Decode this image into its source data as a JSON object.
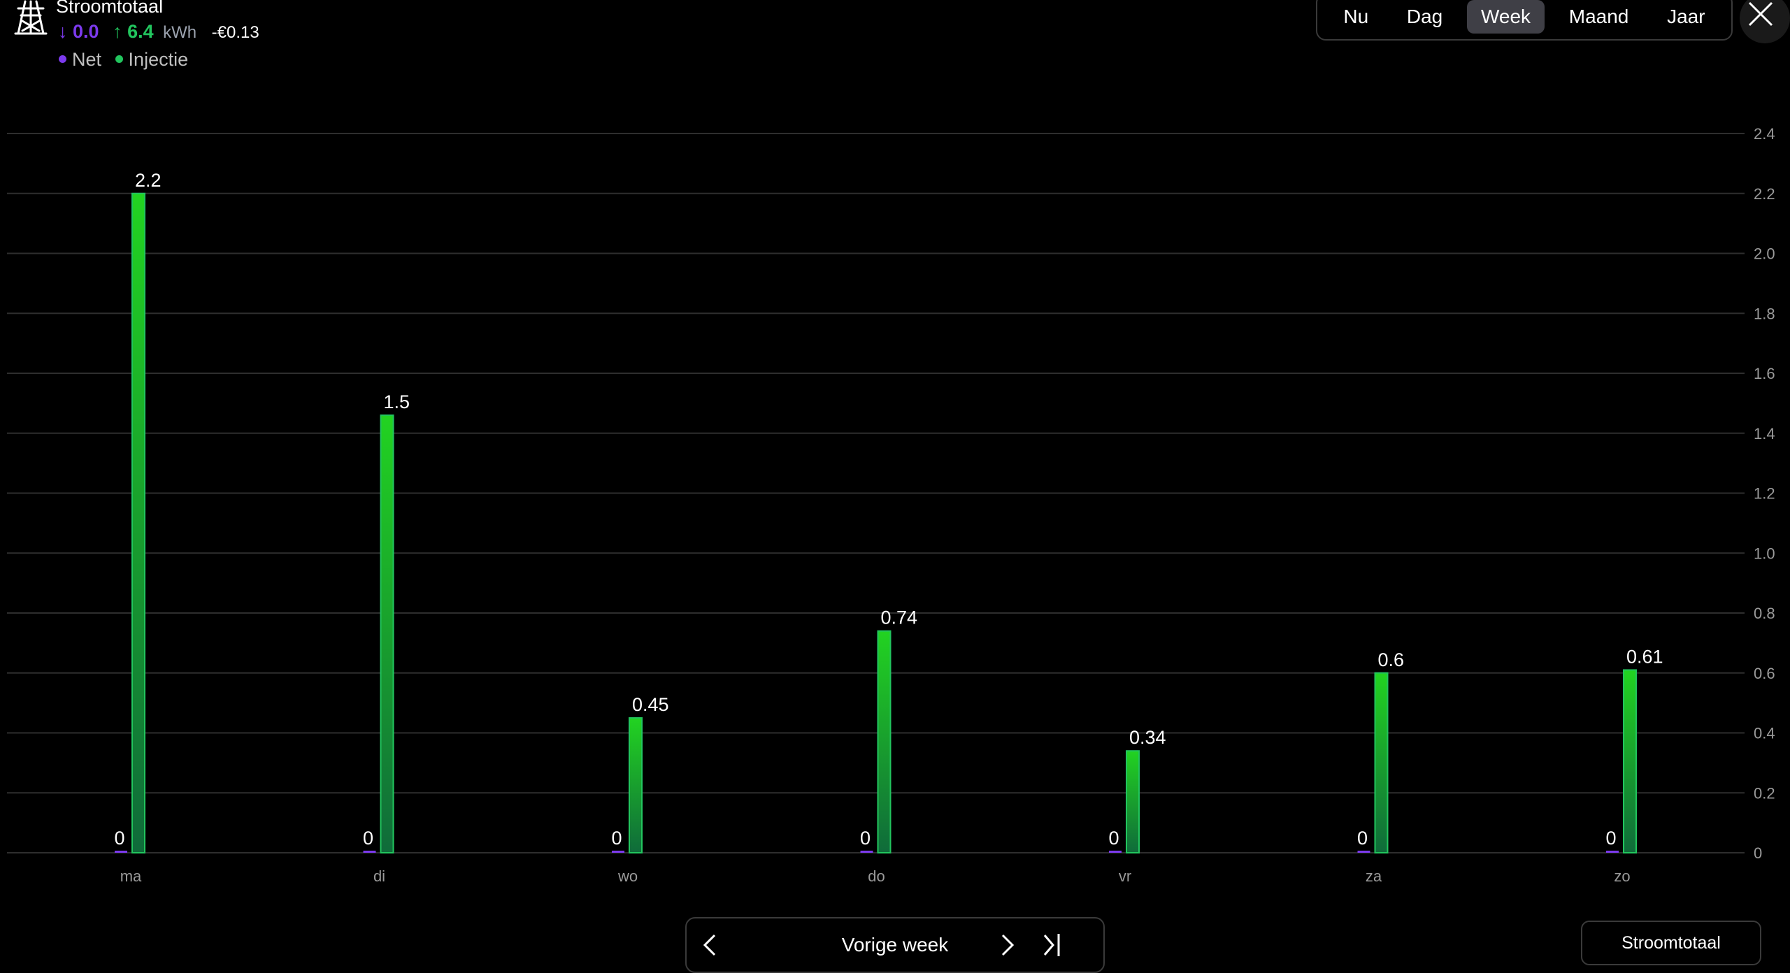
{
  "header": {
    "title": "Stroomtotaal",
    "net_value": "0.0",
    "injection_value": "6.4",
    "unit": "kWh",
    "cost": "-€0.13",
    "legend": [
      {
        "label": "Net",
        "color": "#7c3aed"
      },
      {
        "label": "Injectie",
        "color": "#22c55e"
      }
    ],
    "icon": "power-tower-icon"
  },
  "tabs": [
    {
      "label": "Nu",
      "active": false
    },
    {
      "label": "Dag",
      "active": false
    },
    {
      "label": "Week",
      "active": true
    },
    {
      "label": "Maand",
      "active": false
    },
    {
      "label": "Jaar",
      "active": false
    }
  ],
  "close_icon": "close-icon",
  "navigation": {
    "label": "Vorige week",
    "prev_icon": "chevron-left-icon",
    "next_icon": "chevron-right-icon",
    "last_icon": "skip-to-end-icon"
  },
  "source_button": {
    "label": "Stroomtotaal"
  },
  "chart_data": {
    "type": "bar",
    "categories": [
      "ma",
      "di",
      "wo",
      "do",
      "vr",
      "za",
      "zo"
    ],
    "series": [
      {
        "name": "Net",
        "color": "#7c3aed",
        "values": [
          0,
          0,
          0,
          0,
          0,
          0,
          0
        ],
        "labels": [
          "0",
          "0",
          "0",
          "0",
          "0",
          "0",
          "0"
        ]
      },
      {
        "name": "Injectie",
        "color": "#22c55e",
        "values": [
          2.2,
          1.46,
          0.45,
          0.74,
          0.34,
          0.6,
          0.61
        ],
        "labels": [
          "2.2",
          "1.5",
          "0.45",
          "0.74",
          "0.34",
          "0.6",
          "0.61"
        ]
      }
    ],
    "yticks": [
      "0",
      "0.2",
      "0.4",
      "0.6",
      "0.8",
      "1.0",
      "1.2",
      "1.4",
      "1.6",
      "1.8",
      "2.0",
      "2.2",
      "2.4"
    ],
    "ylim": [
      0,
      2.4
    ],
    "y_axis_position": "right",
    "grid": true
  }
}
